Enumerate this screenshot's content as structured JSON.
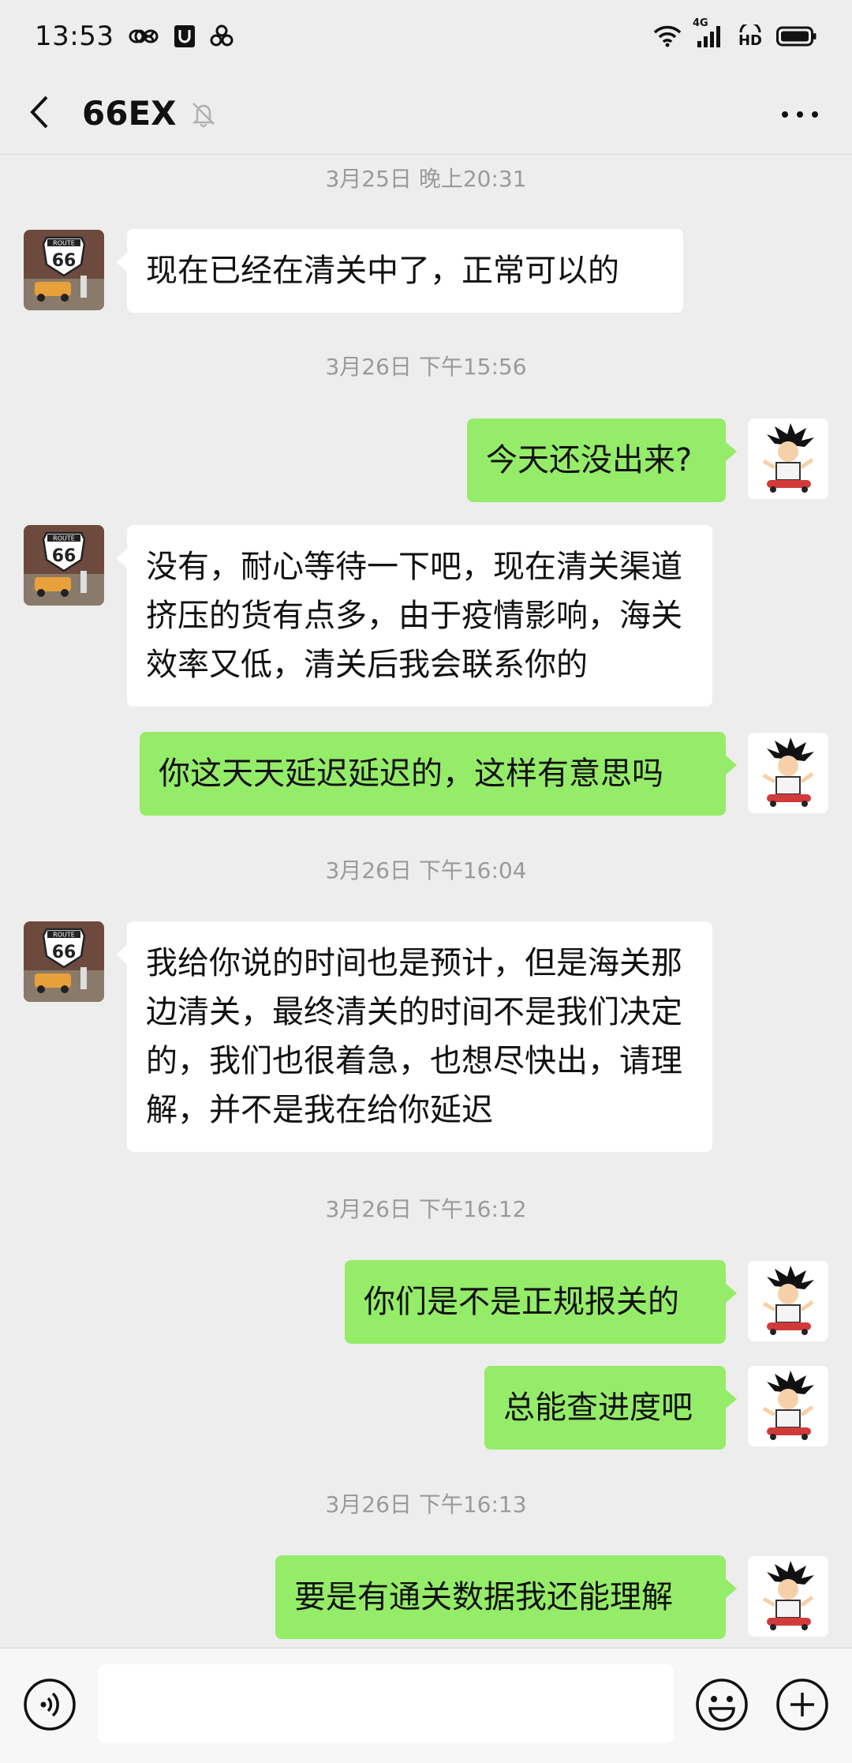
{
  "status_bar": {
    "time": "13:53",
    "left_icons": [
      "infinity-icon",
      "shield-icon",
      "cloverleaf-icon"
    ],
    "network_label": "4G",
    "hd_label": "HD",
    "right_icons": [
      "wifi-icon",
      "signal-icon",
      "hd-icon",
      "battery-icon"
    ]
  },
  "header": {
    "title": "66EX",
    "muted": true
  },
  "messages": [
    {
      "type": "timestamp",
      "text": "3月25日 晚上20:31"
    },
    {
      "type": "message",
      "side": "left",
      "text": "现在已经在清关中了，正常可以的"
    },
    {
      "type": "timestamp",
      "text": "3月26日 下午15:56"
    },
    {
      "type": "message",
      "side": "right",
      "text": "今天还没出来?"
    },
    {
      "type": "message",
      "side": "left",
      "text": "没有，耐心等待一下吧，现在清关渠道挤压的货有点多，由于疫情影响，海关效率又低，清关后我会联系你的"
    },
    {
      "type": "message",
      "side": "right",
      "text": "你这天天延迟延迟的，这样有意思吗"
    },
    {
      "type": "timestamp",
      "text": "3月26日 下午16:04"
    },
    {
      "type": "message",
      "side": "left",
      "text": "我给你说的时间也是预计，但是海关那边清关，最终清关的时间不是我们决定的，我们也很着急，也想尽快出，请理解，并不是我在给你延迟"
    },
    {
      "type": "timestamp",
      "text": "3月26日 下午16:12"
    },
    {
      "type": "message",
      "side": "right",
      "text": "你们是不是正规报关的"
    },
    {
      "type": "message",
      "side": "right",
      "text": "总能查进度吧"
    },
    {
      "type": "timestamp",
      "text": "3月26日 下午16:13"
    },
    {
      "type": "message",
      "side": "right",
      "text": "要是有通关数据我还能理解"
    }
  ],
  "avatars": {
    "left": {
      "badge_top": "ROUTE",
      "badge_number": "66"
    },
    "right": {
      "icon": "cartoon-character"
    }
  },
  "input": {
    "value": "",
    "placeholder": ""
  },
  "colors": {
    "background": "#ededed",
    "sent_bubble": "#95ec69",
    "received_bubble": "#ffffff",
    "timestamp": "#9a9a9a"
  }
}
